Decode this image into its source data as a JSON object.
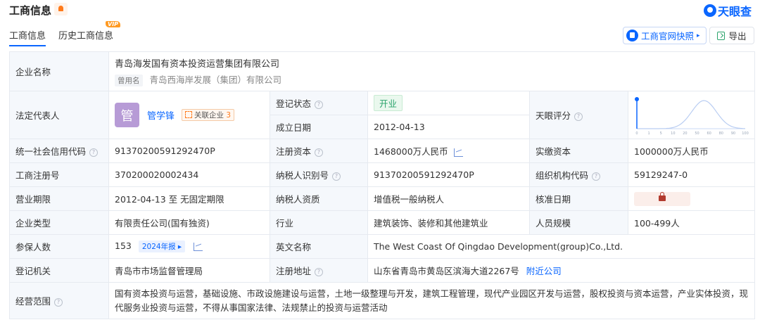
{
  "header": {
    "title": "工商信息",
    "logo": "天眼查"
  },
  "tabs": [
    {
      "label": "工商信息",
      "active": true
    },
    {
      "label": "历史工商信息",
      "badge": "VIP"
    }
  ],
  "actions": {
    "snapshot_label": "工商官网快照",
    "export_label": "导出"
  },
  "company": {
    "name_label": "企业名称",
    "name": "青岛海发国有资本投资运营集团有限公司",
    "former_label": "曾用名",
    "former_name": "青岛西海岸发展（集团）有限公司"
  },
  "legal_rep": {
    "label": "法定代表人",
    "avatar_char": "管",
    "name": "管学锋",
    "related_label": "关联企业",
    "related_count": "3"
  },
  "status": {
    "label": "登记状态",
    "value": "开业"
  },
  "founded": {
    "label": "成立日期",
    "value": "2012-04-13"
  },
  "score": {
    "label": "天眼评分",
    "chart_data": {
      "type": "line",
      "x": [
        0,
        1,
        5,
        10,
        20,
        50,
        60,
        80,
        90,
        100
      ],
      "xticks": [
        "0",
        "1",
        "5",
        "10",
        "20",
        "50",
        "60",
        "80",
        "90",
        "100"
      ],
      "marker_x": 0
    }
  },
  "rows": {
    "credit_code": {
      "label": "统一社会信用代码",
      "value": "91370200591292470P"
    },
    "reg_capital": {
      "label": "注册资本",
      "value": "1468000万人民币"
    },
    "paid_capital": {
      "label": "实缴资本",
      "value": "1000000万人民币"
    },
    "reg_no": {
      "label": "工商注册号",
      "value": "370200020002434"
    },
    "taxpayer_id": {
      "label": "纳税人识别号",
      "value": "91370200591292470P"
    },
    "org_code": {
      "label": "组织机构代码",
      "value": "59129247-0"
    },
    "term": {
      "label": "营业期限",
      "value": "2012-04-13 至 无固定期限"
    },
    "taxpayer_type": {
      "label": "纳税人资质",
      "value": "增值税一般纳税人"
    },
    "approval_date": {
      "label": "核准日期"
    },
    "company_type": {
      "label": "企业类型",
      "value": "有限责任公司(国有独资)"
    },
    "industry": {
      "label": "行业",
      "value": "建筑装饰、装修和其他建筑业"
    },
    "staff_size": {
      "label": "人员规模",
      "value": "100-499人"
    },
    "insured": {
      "label": "参保人数",
      "value": "153",
      "year": "2024年报"
    },
    "english_name": {
      "label": "英文名称",
      "value": "The West Coast Of Qingdao Development(group)Co.,Ltd."
    },
    "reg_authority": {
      "label": "登记机关",
      "value": "青岛市市场监督管理局"
    },
    "reg_address": {
      "label": "注册地址",
      "value": "山东省青岛市黄岛区滨海大道2267号",
      "link": "附近公司"
    },
    "scope": {
      "label": "经营范围",
      "value": "国有资本投资与运营，基础设施、市政设施建设与运营，土地一级整理与开发，建筑工程管理，现代产业园区开发与运营，股权投资与资本运营，产业实体投资，现代服务业投资与运营，不得从事国家法律、法规禁止的投资与运营活动"
    }
  }
}
